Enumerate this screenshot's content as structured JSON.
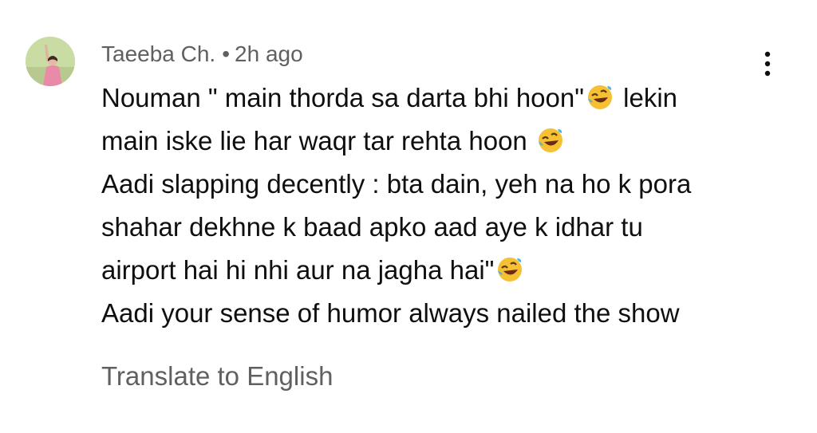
{
  "comment": {
    "author": "Taeeba Ch.",
    "separator": "•",
    "time": "2h ago",
    "lines": {
      "l1a": "Nouman \" main thorda sa darta bhi hoon\"",
      "l1b": " lekin",
      "l2a": "main iske lie har waqr tar rehta hoon ",
      "l3": "Aadi slapping decently  : bta dain, yeh na ho k pora",
      "l4": "shahar dekhne k baad apko aad aye k idhar tu",
      "l5a": "airport hai hi nhi aur na jagha hai\"",
      "l6": "Aadi your sense of humor always nailed the show"
    },
    "emoji_icon": "rolling-on-the-floor-laughing-emoji",
    "translate_label": "Translate to English"
  },
  "icons": {
    "more": "more-vertical-icon",
    "avatar": "user-avatar"
  },
  "colors": {
    "text": "#0f0f0f",
    "secondary": "#606060",
    "background": "#ffffff"
  }
}
